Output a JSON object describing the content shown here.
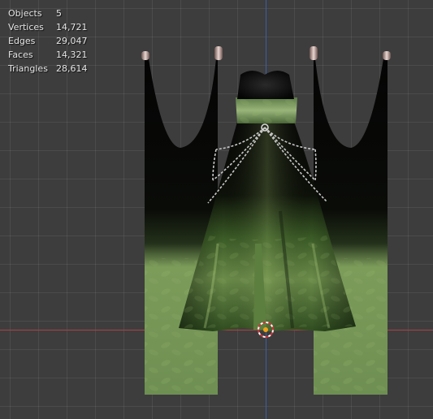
{
  "viewport": {
    "axis_x_color": "#b14045",
    "axis_z_color": "#3c5fa8",
    "grid_color": "#4a4a4a",
    "background": "#3d3d3d"
  },
  "stats": {
    "objects_label": "Objects",
    "objects_value": "5",
    "vertices_label": "Vertices",
    "vertices_value": "14,721",
    "edges_label": "Edges",
    "edges_value": "29,047",
    "faces_label": "Faces",
    "faces_value": "14,321",
    "triangles_label": "Triangles",
    "triangles_value": "28,614"
  },
  "scene": {
    "objects": [
      "left-curtain",
      "right-curtain",
      "dress",
      "chains",
      "curtain-rings"
    ],
    "curtain_top_color": "#050505",
    "curtain_bottom_color": "#7a9a5a",
    "dress_color": "#3f6a2e",
    "cursor_icon": "3d-cursor-icon"
  }
}
